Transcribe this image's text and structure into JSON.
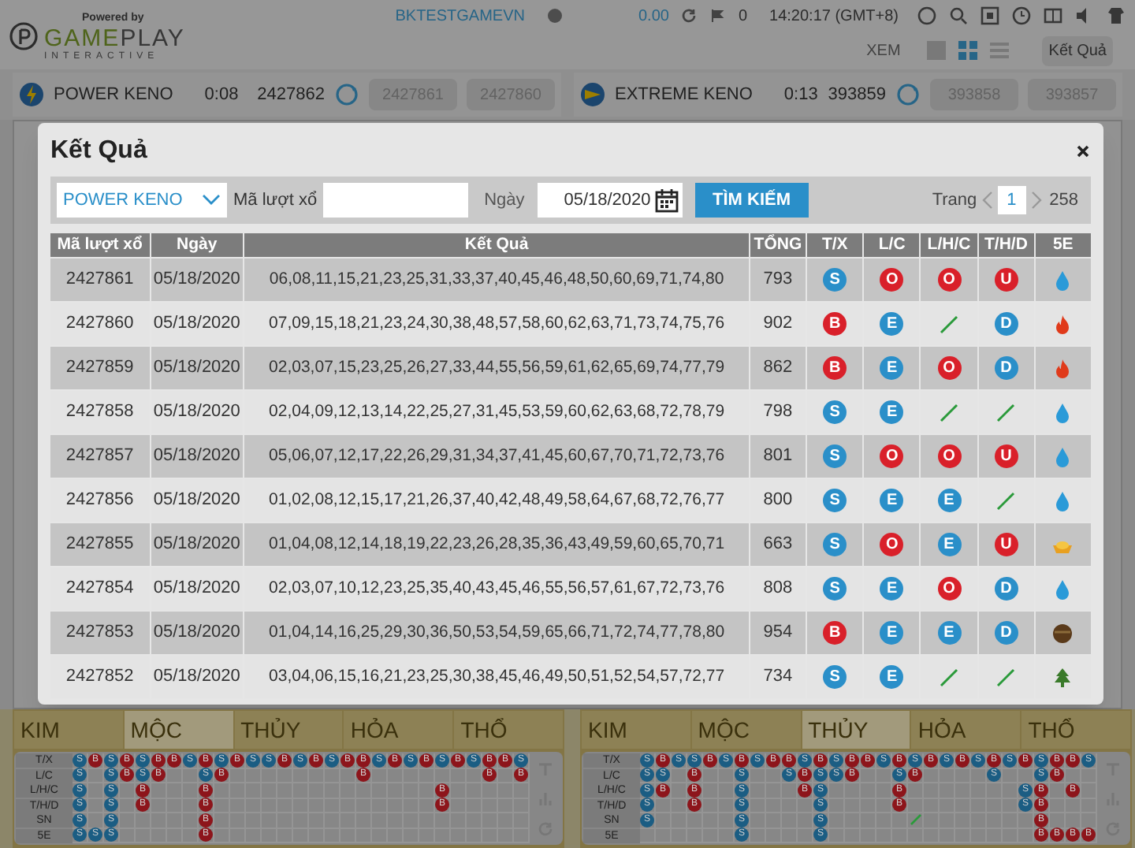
{
  "header": {
    "logo": {
      "powered_by": "Powered by",
      "brand_1": "GAME",
      "brand_2": "PLAY",
      "tagline": "INTERACTIVE"
    },
    "username": "BKTESTGAMEVN",
    "balance": "0.00",
    "count": "0",
    "time": "14:20:17 (GMT+8)",
    "view_label": "XEM",
    "view_modes": [
      {
        "kind": "single",
        "selected": false
      },
      {
        "kind": "grid",
        "selected": true
      },
      {
        "kind": "list",
        "selected": false
      }
    ],
    "tooltip": "Kết Quả"
  },
  "games": [
    {
      "kind": "power",
      "name": "POWER KENO",
      "timer": "0:08",
      "current_draw": "2427862",
      "previous_draws": [
        "2427861",
        "2427860"
      ]
    },
    {
      "kind": "extreme",
      "name": "EXTREME KENO",
      "timer": "0:13",
      "current_draw": "393859",
      "previous_draws": [
        "393858",
        "393857"
      ]
    }
  ],
  "modal": {
    "title": "Kết Quả",
    "game_select": "POWER KENO",
    "draw_label": "Mã lượt xổ",
    "date_label": "Ngày",
    "date_value": "05/18/2020",
    "search_button": "TÌM KIẾM",
    "page_label": "Trang",
    "page": "1",
    "page_count": "258",
    "columns": [
      "Mã lượt xổ",
      "Ngày",
      "Kết Quả",
      "TỔNG",
      "T/X",
      "L/C",
      "L/H/C",
      "T/H/D",
      "5E"
    ],
    "rows": [
      {
        "draw": "2427861",
        "date": "05/18/2020",
        "result": "06,08,11,15,21,23,25,31,33,37,40,45,46,48,50,60,69,71,74,80",
        "total": "793",
        "marks": [
          {
            "kind": "badge",
            "text": "S",
            "color": "#2a8fc9"
          },
          {
            "kind": "badge",
            "text": "O",
            "color": "#d9202a"
          },
          {
            "kind": "badge",
            "text": "O",
            "color": "#d9202a"
          },
          {
            "kind": "badge",
            "text": "U",
            "color": "#d9202a"
          }
        ],
        "element": {
          "kind": "water"
        }
      },
      {
        "draw": "2427860",
        "date": "05/18/2020",
        "result": "07,09,15,18,21,23,24,30,38,48,57,58,60,62,63,71,73,74,75,76",
        "total": "902",
        "marks": [
          {
            "kind": "badge",
            "text": "B",
            "color": "#d9202a"
          },
          {
            "kind": "badge",
            "text": "E",
            "color": "#2a8fc9"
          },
          {
            "kind": "slash"
          },
          {
            "kind": "badge",
            "text": "D",
            "color": "#2a8fc9"
          }
        ],
        "element": {
          "kind": "fire"
        }
      },
      {
        "draw": "2427859",
        "date": "05/18/2020",
        "result": "02,03,07,15,23,25,26,27,33,44,55,56,59,61,62,65,69,74,77,79",
        "total": "862",
        "marks": [
          {
            "kind": "badge",
            "text": "B",
            "color": "#d9202a"
          },
          {
            "kind": "badge",
            "text": "E",
            "color": "#2a8fc9"
          },
          {
            "kind": "badge",
            "text": "O",
            "color": "#d9202a"
          },
          {
            "kind": "badge",
            "text": "D",
            "color": "#2a8fc9"
          }
        ],
        "element": {
          "kind": "fire"
        }
      },
      {
        "draw": "2427858",
        "date": "05/18/2020",
        "result": "02,04,09,12,13,14,22,25,27,31,45,53,59,60,62,63,68,72,78,79",
        "total": "798",
        "marks": [
          {
            "kind": "badge",
            "text": "S",
            "color": "#2a8fc9"
          },
          {
            "kind": "badge",
            "text": "E",
            "color": "#2a8fc9"
          },
          {
            "kind": "slash"
          },
          {
            "kind": "slash"
          }
        ],
        "element": {
          "kind": "water"
        }
      },
      {
        "draw": "2427857",
        "date": "05/18/2020",
        "result": "05,06,07,12,17,22,26,29,31,34,37,41,45,60,67,70,71,72,73,76",
        "total": "801",
        "marks": [
          {
            "kind": "badge",
            "text": "S",
            "color": "#2a8fc9"
          },
          {
            "kind": "badge",
            "text": "O",
            "color": "#d9202a"
          },
          {
            "kind": "badge",
            "text": "O",
            "color": "#d9202a"
          },
          {
            "kind": "badge",
            "text": "U",
            "color": "#d9202a"
          }
        ],
        "element": {
          "kind": "water"
        }
      },
      {
        "draw": "2427856",
        "date": "05/18/2020",
        "result": "01,02,08,12,15,17,21,26,37,40,42,48,49,58,64,67,68,72,76,77",
        "total": "800",
        "marks": [
          {
            "kind": "badge",
            "text": "S",
            "color": "#2a8fc9"
          },
          {
            "kind": "badge",
            "text": "E",
            "color": "#2a8fc9"
          },
          {
            "kind": "badge",
            "text": "E",
            "color": "#2a8fc9"
          },
          {
            "kind": "slash"
          }
        ],
        "element": {
          "kind": "water"
        }
      },
      {
        "draw": "2427855",
        "date": "05/18/2020",
        "result": "01,04,08,12,14,18,19,22,23,26,28,35,36,43,49,59,60,65,70,71",
        "total": "663",
        "marks": [
          {
            "kind": "badge",
            "text": "S",
            "color": "#2a8fc9"
          },
          {
            "kind": "badge",
            "text": "O",
            "color": "#d9202a"
          },
          {
            "kind": "badge",
            "text": "E",
            "color": "#2a8fc9"
          },
          {
            "kind": "badge",
            "text": "U",
            "color": "#d9202a"
          }
        ],
        "element": {
          "kind": "gold"
        }
      },
      {
        "draw": "2427854",
        "date": "05/18/2020",
        "result": "02,03,07,10,12,23,25,35,40,43,45,46,55,56,57,61,67,72,73,76",
        "total": "808",
        "marks": [
          {
            "kind": "badge",
            "text": "S",
            "color": "#2a8fc9"
          },
          {
            "kind": "badge",
            "text": "E",
            "color": "#2a8fc9"
          },
          {
            "kind": "badge",
            "text": "O",
            "color": "#d9202a"
          },
          {
            "kind": "badge",
            "text": "D",
            "color": "#2a8fc9"
          }
        ],
        "element": {
          "kind": "water"
        }
      },
      {
        "draw": "2427853",
        "date": "05/18/2020",
        "result": "01,04,14,16,25,29,30,36,50,53,54,59,65,66,71,72,74,77,78,80",
        "total": "954",
        "marks": [
          {
            "kind": "badge",
            "text": "B",
            "color": "#d9202a"
          },
          {
            "kind": "badge",
            "text": "E",
            "color": "#2a8fc9"
          },
          {
            "kind": "badge",
            "text": "E",
            "color": "#2a8fc9"
          },
          {
            "kind": "badge",
            "text": "D",
            "color": "#2a8fc9"
          }
        ],
        "element": {
          "kind": "earth"
        }
      },
      {
        "draw": "2427852",
        "date": "05/18/2020",
        "result": "03,04,06,15,16,21,23,25,30,38,45,46,49,50,51,52,54,57,72,77",
        "total": "734",
        "marks": [
          {
            "kind": "badge",
            "text": "S",
            "color": "#2a8fc9"
          },
          {
            "kind": "badge",
            "text": "E",
            "color": "#2a8fc9"
          },
          {
            "kind": "slash"
          },
          {
            "kind": "slash"
          }
        ],
        "element": {
          "kind": "wood"
        }
      }
    ]
  },
  "boards": [
    {
      "elements": [
        {
          "label": "KIM",
          "selected": false
        },
        {
          "label": "MỘC",
          "selected": true
        },
        {
          "label": "THỦY",
          "selected": false
        },
        {
          "label": "HỎA",
          "selected": false
        },
        {
          "label": "THỔ",
          "selected": false
        }
      ],
      "rows": [
        {
          "label": "T/X",
          "cells": [
            {
              "text": "S",
              "color": "#1b5d83"
            },
            {
              "text": "B",
              "color": "#8d151b"
            },
            {
              "text": "S",
              "color": "#1b5d83"
            },
            {
              "text": "B",
              "color": "#8d151b"
            },
            {
              "text": "S",
              "color": "#1b5d83"
            },
            {
              "text": "B",
              "color": "#8d151b"
            },
            {
              "text": "B",
              "color": "#8d151b"
            },
            {
              "text": "S",
              "color": "#1b5d83"
            },
            {
              "text": "B",
              "color": "#8d151b"
            },
            {
              "text": "S",
              "color": "#1b5d83"
            },
            {
              "text": "B",
              "color": "#8d151b"
            },
            {
              "text": "S",
              "color": "#1b5d83"
            },
            {
              "text": "S",
              "color": "#1b5d83"
            },
            {
              "text": "B",
              "color": "#8d151b"
            },
            {
              "text": "S",
              "color": "#1b5d83"
            },
            {
              "text": "B",
              "color": "#8d151b"
            },
            {
              "text": "S",
              "color": "#1b5d83"
            },
            {
              "text": "B",
              "color": "#8d151b"
            },
            {
              "text": "B",
              "color": "#8d151b"
            },
            {
              "text": "S",
              "color": "#1b5d83"
            },
            {
              "text": "B",
              "color": "#8d151b"
            },
            {
              "text": "S",
              "color": "#1b5d83"
            },
            {
              "text": "B",
              "color": "#8d151b"
            },
            {
              "text": "S",
              "color": "#1b5d83"
            },
            {
              "text": "B",
              "color": "#8d151b"
            },
            {
              "text": "S",
              "color": "#1b5d83"
            },
            {
              "text": "B",
              "color": "#8d151b"
            },
            {
              "text": "B",
              "color": "#8d151b"
            },
            {
              "text": "S",
              "color": "#1b5d83"
            }
          ]
        },
        {
          "label": "L/C",
          "cells": [
            {
              "text": "S",
              "color": "#1b5d83"
            },
            null,
            {
              "text": "S",
              "color": "#1b5d83"
            },
            {
              "text": "B",
              "color": "#8d151b"
            },
            {
              "text": "S",
              "color": "#1b5d83"
            },
            {
              "text": "B",
              "color": "#8d151b"
            },
            null,
            null,
            {
              "text": "S",
              "color": "#1b5d83"
            },
            {
              "text": "B",
              "color": "#8d151b"
            },
            null,
            null,
            null,
            null,
            null,
            null,
            null,
            null,
            {
              "text": "B",
              "color": "#8d151b"
            },
            null,
            null,
            null,
            null,
            null,
            null,
            null,
            {
              "text": "B",
              "color": "#8d151b"
            },
            null,
            {
              "text": "B",
              "color": "#8d151b"
            }
          ]
        },
        {
          "label": "L/H/C",
          "cells": [
            {
              "text": "S",
              "color": "#1b5d83"
            },
            null,
            {
              "text": "S",
              "color": "#1b5d83"
            },
            null,
            {
              "text": "B",
              "color": "#8d151b"
            },
            null,
            null,
            null,
            {
              "text": "B",
              "color": "#8d151b"
            },
            null,
            null,
            null,
            null,
            null,
            null,
            null,
            null,
            null,
            null,
            null,
            null,
            null,
            null,
            {
              "text": "B",
              "color": "#8d151b"
            }
          ]
        },
        {
          "label": "T/H/D",
          "cells": [
            {
              "text": "S",
              "color": "#1b5d83"
            },
            null,
            {
              "text": "S",
              "color": "#1b5d83"
            },
            null,
            {
              "text": "B",
              "color": "#8d151b"
            },
            null,
            null,
            null,
            {
              "text": "B",
              "color": "#8d151b"
            },
            null,
            null,
            null,
            null,
            null,
            null,
            null,
            null,
            null,
            null,
            null,
            null,
            null,
            null,
            {
              "text": "B",
              "color": "#8d151b"
            }
          ]
        },
        {
          "label": "SN",
          "cells": [
            {
              "text": "S",
              "color": "#1b5d83"
            },
            null,
            {
              "text": "S",
              "color": "#1b5d83"
            },
            null,
            null,
            null,
            null,
            null,
            {
              "text": "B",
              "color": "#8d151b"
            }
          ]
        },
        {
          "label": "5E",
          "cells": [
            {
              "text": "S",
              "color": "#1b5d83"
            },
            {
              "text": "S",
              "color": "#1b5d83"
            },
            {
              "text": "S",
              "color": "#1b5d83"
            },
            null,
            null,
            null,
            null,
            null,
            {
              "text": "B",
              "color": "#8d151b"
            }
          ]
        }
      ]
    },
    {
      "elements": [
        {
          "label": "KIM",
          "selected": false
        },
        {
          "label": "MỘC",
          "selected": false
        },
        {
          "label": "THỦY",
          "selected": true
        },
        {
          "label": "HỎA",
          "selected": false
        },
        {
          "label": "THỔ",
          "selected": false
        }
      ],
      "rows": [
        {
          "label": "T/X",
          "cells": [
            {
              "text": "S",
              "color": "#1b5d83"
            },
            {
              "text": "B",
              "color": "#8d151b"
            },
            {
              "text": "S",
              "color": "#1b5d83"
            },
            {
              "text": "S",
              "color": "#1b5d83"
            },
            {
              "text": "B",
              "color": "#8d151b"
            },
            {
              "text": "S",
              "color": "#1b5d83"
            },
            {
              "text": "B",
              "color": "#8d151b"
            },
            {
              "text": "S",
              "color": "#1b5d83"
            },
            {
              "text": "B",
              "color": "#8d151b"
            },
            {
              "text": "B",
              "color": "#8d151b"
            },
            {
              "text": "S",
              "color": "#1b5d83"
            },
            {
              "text": "B",
              "color": "#8d151b"
            },
            {
              "text": "S",
              "color": "#1b5d83"
            },
            {
              "text": "B",
              "color": "#8d151b"
            },
            {
              "text": "B",
              "color": "#8d151b"
            },
            {
              "text": "S",
              "color": "#1b5d83"
            },
            {
              "text": "B",
              "color": "#8d151b"
            },
            {
              "text": "S",
              "color": "#1b5d83"
            },
            {
              "text": "B",
              "color": "#8d151b"
            },
            {
              "text": "S",
              "color": "#1b5d83"
            },
            {
              "text": "B",
              "color": "#8d151b"
            },
            {
              "text": "S",
              "color": "#1b5d83"
            },
            {
              "text": "B",
              "color": "#8d151b"
            },
            {
              "text": "S",
              "color": "#1b5d83"
            },
            {
              "text": "B",
              "color": "#8d151b"
            },
            {
              "text": "S",
              "color": "#1b5d83"
            },
            {
              "text": "B",
              "color": "#8d151b"
            },
            {
              "text": "B",
              "color": "#8d151b"
            },
            {
              "text": "S",
              "color": "#1b5d83"
            }
          ]
        },
        {
          "label": "L/C",
          "cells": [
            {
              "text": "S",
              "color": "#1b5d83"
            },
            {
              "text": "S",
              "color": "#1b5d83"
            },
            null,
            {
              "text": "B",
              "color": "#8d151b"
            },
            null,
            null,
            {
              "text": "S",
              "color": "#1b5d83"
            },
            null,
            null,
            {
              "text": "S",
              "color": "#1b5d83"
            },
            {
              "text": "B",
              "color": "#8d151b"
            },
            {
              "text": "S",
              "color": "#1b5d83"
            },
            {
              "text": "S",
              "color": "#1b5d83"
            },
            {
              "text": "B",
              "color": "#8d151b"
            },
            null,
            null,
            {
              "text": "S",
              "color": "#1b5d83"
            },
            {
              "text": "B",
              "color": "#8d151b"
            },
            null,
            null,
            null,
            null,
            {
              "text": "S",
              "color": "#1b5d83"
            },
            null,
            null,
            {
              "text": "S",
              "color": "#1b5d83"
            },
            {
              "text": "B",
              "color": "#8d151b"
            }
          ]
        },
        {
          "label": "L/H/C",
          "cells": [
            {
              "text": "S",
              "color": "#1b5d83"
            },
            {
              "text": "B",
              "color": "#8d151b"
            },
            null,
            {
              "text": "B",
              "color": "#8d151b"
            },
            null,
            null,
            {
              "text": "S",
              "color": "#1b5d83"
            },
            null,
            null,
            null,
            {
              "text": "B",
              "color": "#8d151b"
            },
            {
              "text": "S",
              "color": "#1b5d83"
            },
            null,
            null,
            null,
            null,
            {
              "text": "B",
              "color": "#8d151b"
            },
            null,
            null,
            null,
            null,
            null,
            null,
            null,
            {
              "text": "S",
              "color": "#1b5d83"
            },
            {
              "text": "B",
              "color": "#8d151b"
            },
            null,
            {
              "text": "B",
              "color": "#8d151b"
            }
          ]
        },
        {
          "label": "T/H/D",
          "cells": [
            {
              "text": "S",
              "color": "#1b5d83"
            },
            null,
            null,
            {
              "text": "B",
              "color": "#8d151b"
            },
            null,
            null,
            {
              "text": "S",
              "color": "#1b5d83"
            },
            null,
            null,
            null,
            null,
            {
              "text": "S",
              "color": "#1b5d83"
            },
            null,
            null,
            null,
            null,
            {
              "text": "B",
              "color": "#8d151b"
            },
            null,
            null,
            null,
            null,
            null,
            null,
            null,
            {
              "text": "S",
              "color": "#1b5d83"
            },
            {
              "text": "B",
              "color": "#8d151b"
            }
          ]
        },
        {
          "label": "SN",
          "cells": [
            {
              "text": "S",
              "color": "#1b5d83"
            },
            null,
            null,
            null,
            null,
            null,
            {
              "text": "S",
              "color": "#1b5d83"
            },
            null,
            null,
            null,
            null,
            {
              "text": "S",
              "color": "#1b5d83"
            },
            null,
            null,
            null,
            null,
            null,
            {
              "kind": "slash"
            },
            null,
            null,
            null,
            null,
            null,
            null,
            null,
            {
              "text": "B",
              "color": "#8d151b"
            }
          ]
        },
        {
          "label": "5E",
          "cells": [
            null,
            null,
            null,
            null,
            null,
            null,
            {
              "text": "S",
              "color": "#1b5d83"
            },
            null,
            null,
            null,
            null,
            {
              "text": "S",
              "color": "#1b5d83"
            },
            null,
            null,
            null,
            null,
            null,
            null,
            null,
            null,
            null,
            null,
            null,
            null,
            null,
            {
              "text": "B",
              "color": "#8d151b"
            },
            {
              "text": "B",
              "color": "#8d151b"
            },
            {
              "text": "B",
              "color": "#8d151b"
            },
            {
              "text": "B",
              "color": "#8d151b"
            }
          ]
        }
      ]
    }
  ]
}
